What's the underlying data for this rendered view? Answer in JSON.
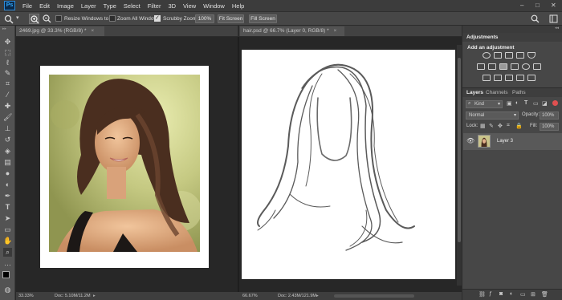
{
  "menubar": {
    "logo": "Ps",
    "items": [
      "File",
      "Edit",
      "Image",
      "Layer",
      "Type",
      "Select",
      "Filter",
      "3D",
      "View",
      "Window",
      "Help"
    ],
    "window_controls": [
      "–",
      "□",
      "✕"
    ]
  },
  "options": {
    "resize_windows_label": "Resize Windows to Fit",
    "zoom_all_label": "Zoom All Windows",
    "scrubby_label": "Scrubby Zoom",
    "zoom_value": "100%",
    "fit_screen_label": "Fit Screen",
    "fill_screen_label": "Fill Screen",
    "resize_checked": false,
    "zoom_all_checked": false,
    "scrubby_checked": true
  },
  "documents": [
    {
      "tab": "2469.jpg @ 33.3% (RGB/8) *",
      "zoom": "33.33%",
      "doc": "Doc: 5.10M/11.2M"
    },
    {
      "tab": "hair.psd @ 66.7% (Layer 0, RGB/8) *",
      "zoom": "66.67%",
      "doc": "Doc: 2.43M/121.9M"
    }
  ],
  "adjustments": {
    "tab": "Adjustments",
    "subtitle": "Add an adjustment"
  },
  "layers": {
    "tabs": [
      "Layers",
      "Channels",
      "Paths"
    ],
    "filter_kind": "Kind",
    "blend_mode": "Normal",
    "opacity_label": "Opacity:",
    "opacity_value": "100%",
    "lock_label": "Lock:",
    "fill_label": "Fill:",
    "fill_value": "100%",
    "items": [
      {
        "name": "Layer 3",
        "visible": true
      }
    ]
  },
  "colors": {
    "accent": "#31a8ff",
    "foreground": "#000000",
    "background": "#ffffff"
  }
}
